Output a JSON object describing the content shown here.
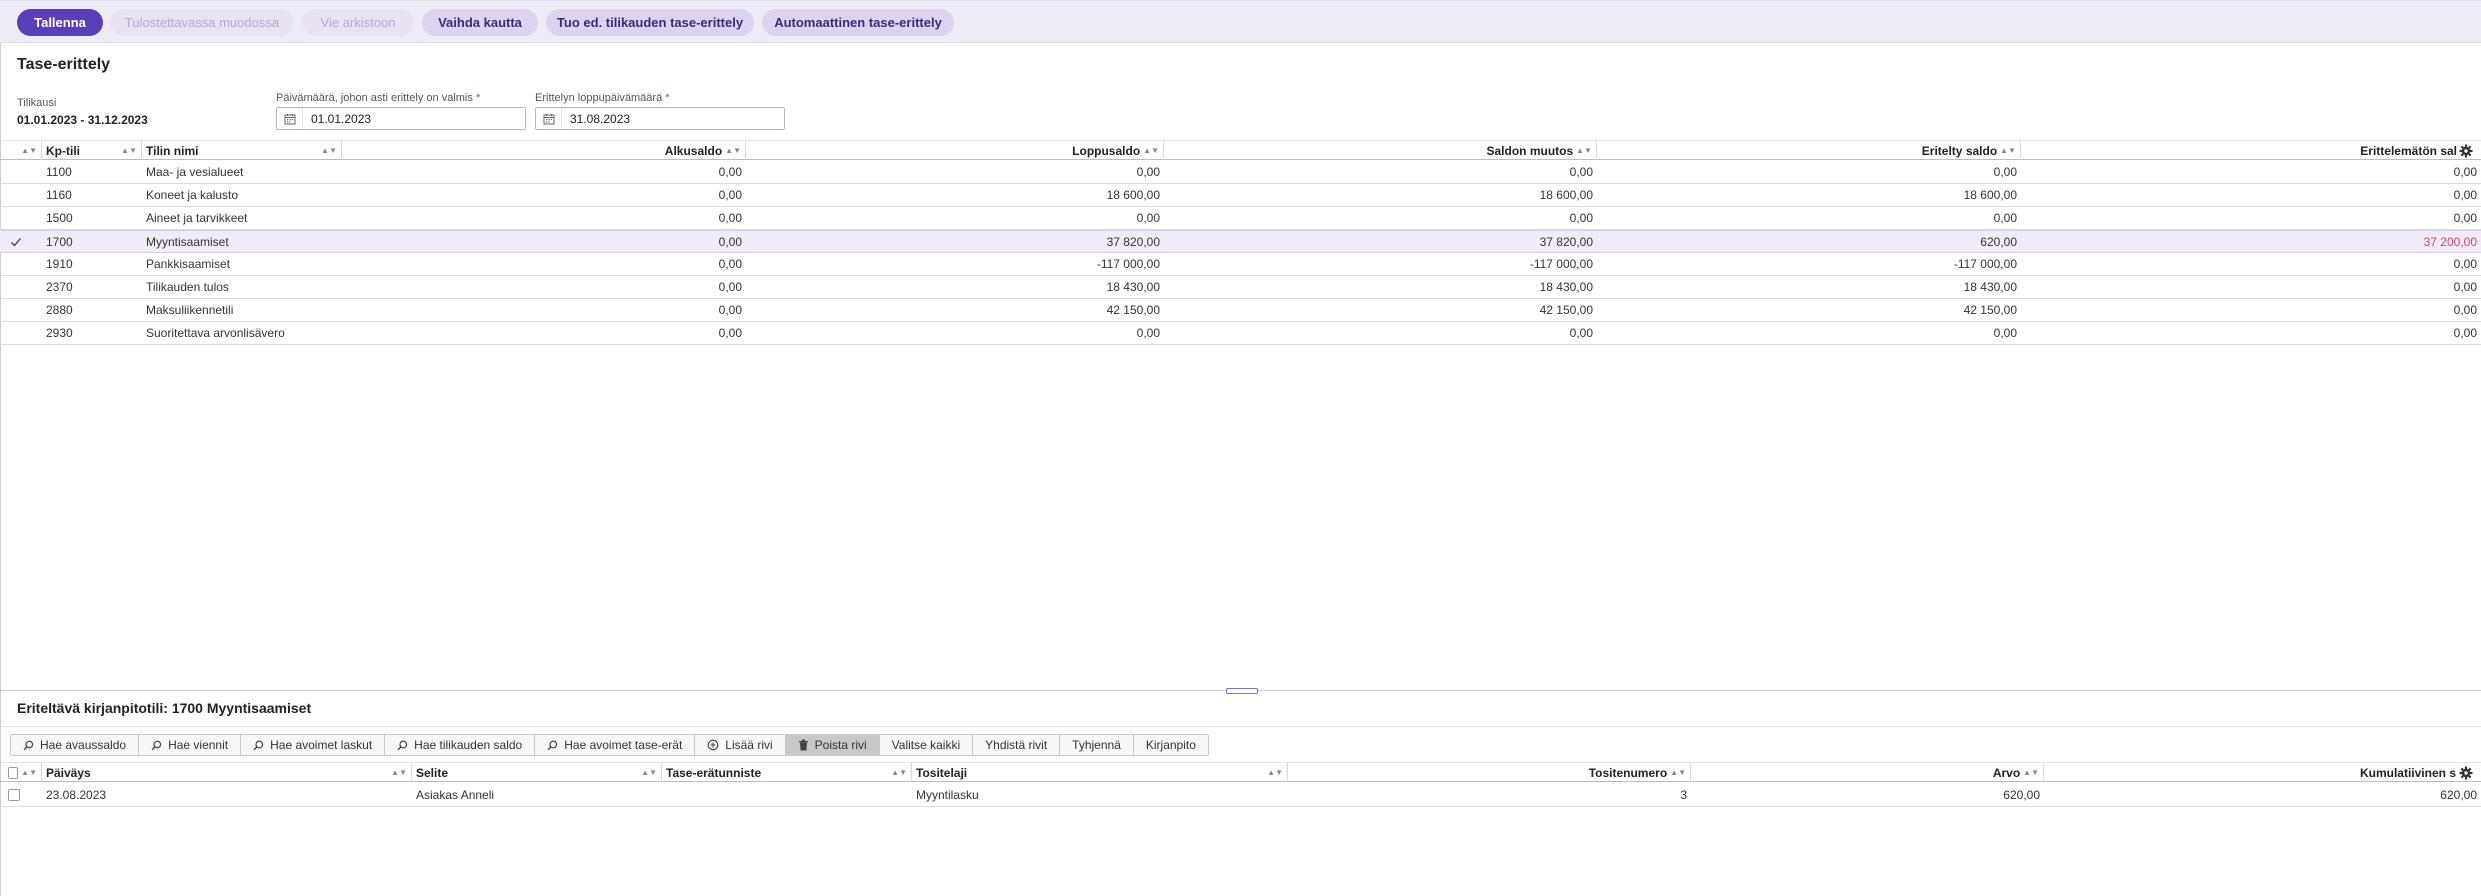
{
  "toolbar": {
    "save": "Tallenna",
    "print_format": "Tulostettavassa muodossa",
    "archive": "Vie arkistoon",
    "change_via": "Vaihda kautta",
    "import_prev": "Tuo ed. tilikauden tase-erittely",
    "auto": "Automaattinen tase-erittely"
  },
  "page": {
    "title": "Tase-erittely",
    "period_label": "Tilikausi",
    "period_value": "01.01.2023 - 31.12.2023",
    "date_ready_label": "Päivämäärä, johon asti erittely on valmis",
    "date_ready_value": "01.01.2023",
    "end_date_label": "Erittelyn loppupäivämäärä",
    "end_date_value": "31.08.2023",
    "required_mark": "*"
  },
  "accounts_table": {
    "headers": {
      "account": "Kp-tili",
      "name": "Tilin nimi",
      "opening": "Alkusaldo",
      "closing": "Loppusaldo",
      "change": "Saldon muutos",
      "itemized": "Eritelty saldo",
      "unitemized": "Erittelemätön sal"
    },
    "rows": [
      {
        "account": "1100",
        "name": "Maa- ja vesialueet",
        "opening": "0,00",
        "closing": "0,00",
        "change": "0,00",
        "itemized": "0,00",
        "unitemized": "0,00",
        "selected": false
      },
      {
        "account": "1160",
        "name": "Koneet ja kalusto",
        "opening": "0,00",
        "closing": "18 600,00",
        "change": "18 600,00",
        "itemized": "18 600,00",
        "unitemized": "0,00",
        "selected": false
      },
      {
        "account": "1500",
        "name": "Aineet ja tarvikkeet",
        "opening": "0,00",
        "closing": "0,00",
        "change": "0,00",
        "itemized": "0,00",
        "unitemized": "0,00",
        "selected": false
      },
      {
        "account": "1700",
        "name": "Myyntisaamiset",
        "opening": "0,00",
        "closing": "37 820,00",
        "change": "37 820,00",
        "itemized": "620,00",
        "unitemized": "37 200,00",
        "selected": true
      },
      {
        "account": "1910",
        "name": "Pankkisaamiset",
        "opening": "0,00",
        "closing": "-117 000,00",
        "change": "-117 000,00",
        "itemized": "-117 000,00",
        "unitemized": "0,00",
        "selected": false
      },
      {
        "account": "2370",
        "name": "Tilikauden tulos",
        "opening": "0,00",
        "closing": "18 430,00",
        "change": "18 430,00",
        "itemized": "18 430,00",
        "unitemized": "0,00",
        "selected": false
      },
      {
        "account": "2880",
        "name": "Maksuliikennetili",
        "opening": "0,00",
        "closing": "42 150,00",
        "change": "42 150,00",
        "itemized": "42 150,00",
        "unitemized": "0,00",
        "selected": false
      },
      {
        "account": "2930",
        "name": "Suoritettava arvonlisävero",
        "opening": "0,00",
        "closing": "0,00",
        "change": "0,00",
        "itemized": "0,00",
        "unitemized": "0,00",
        "selected": false
      }
    ]
  },
  "detail": {
    "title": "Eriteltävä kirjanpitotili: 1700 Myyntisaamiset",
    "buttons": [
      {
        "label": "Hae avaussaldo",
        "icon": "search-icon",
        "active": false
      },
      {
        "label": "Hae viennit",
        "icon": "search-icon",
        "active": false
      },
      {
        "label": "Hae avoimet laskut",
        "icon": "search-icon",
        "active": false
      },
      {
        "label": "Hae tilikauden saldo",
        "icon": "search-icon",
        "active": false
      },
      {
        "label": "Hae avoimet tase-erät",
        "icon": "search-icon",
        "active": false
      },
      {
        "label": "Lisää rivi",
        "icon": "plus-circle-icon",
        "active": false
      },
      {
        "label": "Poista rivi",
        "icon": "trash-icon",
        "active": true
      },
      {
        "label": "Valitse kaikki",
        "icon": "",
        "active": false
      },
      {
        "label": "Yhdistä rivit",
        "icon": "",
        "active": false
      },
      {
        "label": "Tyhjennä",
        "icon": "",
        "active": false
      },
      {
        "label": "Kirjanpito",
        "icon": "",
        "active": false
      }
    ],
    "headers": {
      "date": "Päiväys",
      "desc": "Selite",
      "item_id": "Tase-erätunniste",
      "doc_type": "Tositelaji",
      "doc_no": "Tositenumero",
      "value": "Arvo",
      "cumulative": "Kumulatiivinen s"
    },
    "rows": [
      {
        "date": "23.08.2023",
        "desc": "Asiakas Anneli",
        "item_id": "",
        "doc_type": "Myyntilasku",
        "doc_no": "3",
        "value": "620,00",
        "cumulative": "620,00"
      }
    ]
  },
  "colors": {
    "primary": "#5a3fb8",
    "secondary_btn": "#ddd3f1",
    "toolbar_bg": "#f0ecf7",
    "selected_row": "#f1ecf8",
    "highlight_value": "#d2456f"
  }
}
